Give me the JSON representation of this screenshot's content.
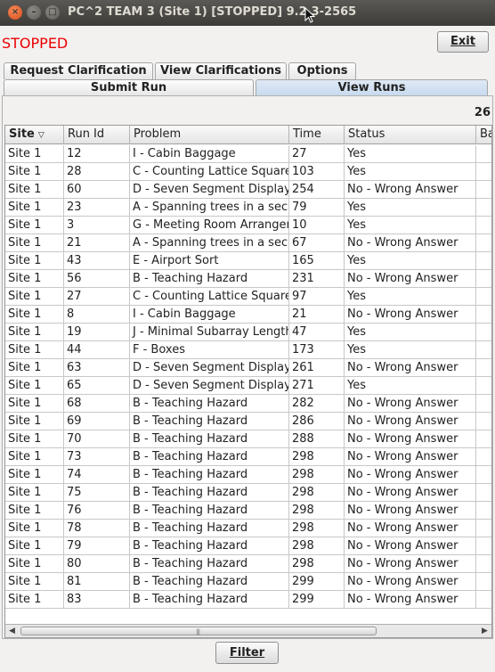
{
  "window": {
    "title": "PC^2 TEAM 3 (Site 1) [STOPPED] 9.2.3-2565",
    "close_glyph": "×",
    "min_glyph": "–",
    "max_glyph": "□"
  },
  "status": {
    "text": "STOPPED",
    "color": "#ee0000"
  },
  "exit_button": {
    "label": "Exit"
  },
  "tabs_top": [
    "Request Clarification",
    "View Clarifications",
    "Options"
  ],
  "tabs_bottom": [
    "Submit Run",
    "View Runs"
  ],
  "selected_tab": "View Runs",
  "run_count": "26",
  "table": {
    "columns": [
      "Site",
      "Run Id",
      "Problem",
      "Time",
      "Status",
      "Ba"
    ],
    "sorted_column": "Site",
    "rows": [
      [
        "Site 1",
        "12",
        "I - Cabin Baggage",
        "27",
        "Yes"
      ],
      [
        "Site 1",
        "28",
        "C - Counting Lattice Squares",
        "103",
        "Yes"
      ],
      [
        "Site 1",
        "60",
        "D - Seven Segment Display",
        "254",
        "No - Wrong Answer"
      ],
      [
        "Site 1",
        "23",
        "A - Spanning trees in a secu",
        "79",
        "Yes"
      ],
      [
        "Site 1",
        "3",
        "G - Meeting Room Arrangem",
        "10",
        "Yes"
      ],
      [
        "Site 1",
        "21",
        "A - Spanning trees in a secu",
        "67",
        "No - Wrong Answer"
      ],
      [
        "Site 1",
        "43",
        "E - Airport Sort",
        "165",
        "Yes"
      ],
      [
        "Site 1",
        "56",
        "B - Teaching Hazard",
        "231",
        "No - Wrong Answer"
      ],
      [
        "Site 1",
        "27",
        "C - Counting Lattice Squares",
        "97",
        "Yes"
      ],
      [
        "Site 1",
        "8",
        "I - Cabin Baggage",
        "21",
        "No - Wrong Answer"
      ],
      [
        "Site 1",
        "19",
        "J - Minimal Subarray Length",
        "47",
        "Yes"
      ],
      [
        "Site 1",
        "44",
        "F - Boxes",
        "173",
        "Yes"
      ],
      [
        "Site 1",
        "63",
        "D - Seven Segment Display",
        "261",
        "No - Wrong Answer"
      ],
      [
        "Site 1",
        "65",
        "D - Seven Segment Display",
        "271",
        "Yes"
      ],
      [
        "Site 1",
        "68",
        "B - Teaching Hazard",
        "282",
        "No - Wrong Answer"
      ],
      [
        "Site 1",
        "69",
        "B - Teaching Hazard",
        "286",
        "No - Wrong Answer"
      ],
      [
        "Site 1",
        "70",
        "B - Teaching Hazard",
        "288",
        "No - Wrong Answer"
      ],
      [
        "Site 1",
        "73",
        "B - Teaching Hazard",
        "298",
        "No - Wrong Answer"
      ],
      [
        "Site 1",
        "74",
        "B - Teaching Hazard",
        "298",
        "No - Wrong Answer"
      ],
      [
        "Site 1",
        "75",
        "B - Teaching Hazard",
        "298",
        "No - Wrong Answer"
      ],
      [
        "Site 1",
        "76",
        "B - Teaching Hazard",
        "298",
        "No - Wrong Answer"
      ],
      [
        "Site 1",
        "78",
        "B - Teaching Hazard",
        "298",
        "No - Wrong Answer"
      ],
      [
        "Site 1",
        "79",
        "B - Teaching Hazard",
        "298",
        "No - Wrong Answer"
      ],
      [
        "Site 1",
        "80",
        "B - Teaching Hazard",
        "298",
        "No - Wrong Answer"
      ],
      [
        "Site 1",
        "81",
        "B - Teaching Hazard",
        "299",
        "No - Wrong Answer"
      ],
      [
        "Site 1",
        "83",
        "B - Teaching Hazard",
        "299",
        "No - Wrong Answer"
      ]
    ]
  },
  "filter_button": {
    "label": "Filter"
  }
}
